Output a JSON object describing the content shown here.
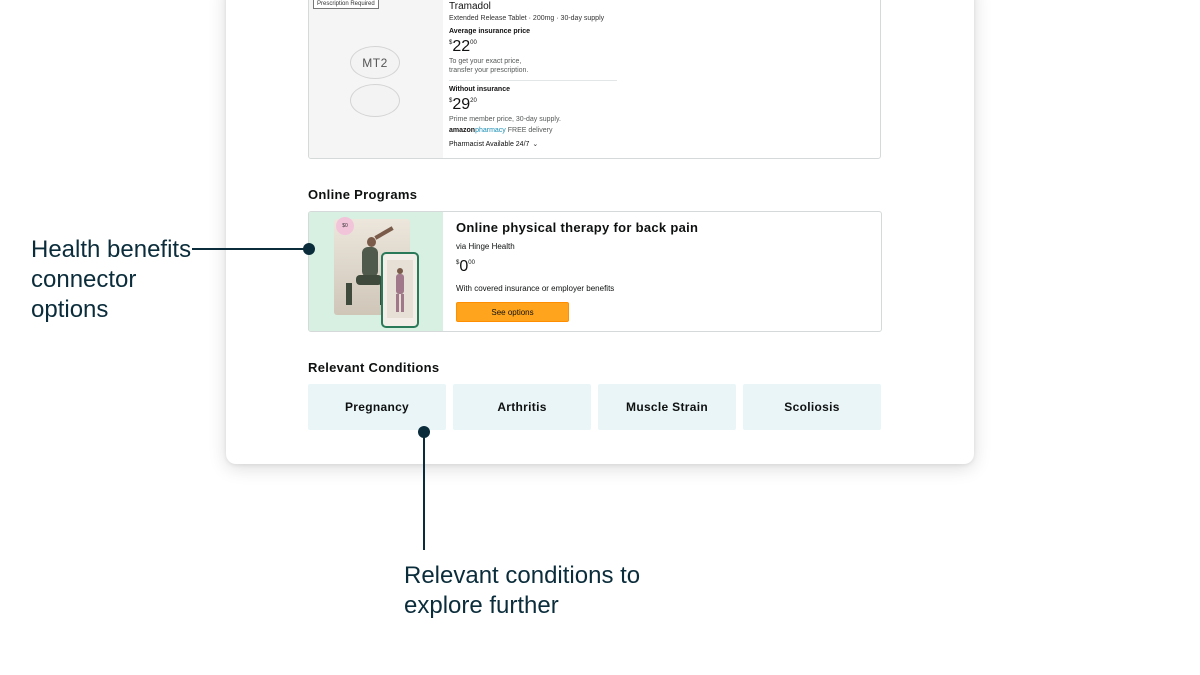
{
  "prescription": {
    "badge": "Prescription Required",
    "pill_imprint": "MT2",
    "name": "Tramadol",
    "form": "Extended Release Tablet · 200mg · 30-day supply",
    "avg_insurance_label": "Average insurance price",
    "avg_insurance_price_whole": "22",
    "avg_insurance_price_cents": "00",
    "price_currency": "$",
    "avg_insurance_note_1": "To get your exact price,",
    "avg_insurance_note_2": "transfer your prescription.",
    "without_insurance_label": "Without insurance",
    "without_insurance_price_whole": "29",
    "without_insurance_price_cents": "20",
    "without_insurance_note": "Prime member price, 30-day supply.",
    "logo_amazon": "amazon",
    "logo_pharmacy": "pharmacy",
    "delivery": "FREE delivery",
    "pharmacist": "Pharmacist Available 24/7"
  },
  "online_programs": {
    "section_title": "Online Programs",
    "image_badge": "$0",
    "title": "Online physical therapy for back pain",
    "via": "via Hinge Health",
    "price_currency": "$",
    "price_whole": "0",
    "price_cents": "00",
    "coverage": "With covered insurance or employer benefits",
    "button_label": "See options"
  },
  "relevant_conditions": {
    "section_title": "Relevant Conditions",
    "items": [
      "Pregnancy",
      "Arthritis",
      "Muscle Strain",
      "Scoliosis"
    ]
  },
  "annotations": {
    "health_benefits": [
      "Health benefits",
      "connector",
      "options"
    ],
    "relevant_conditions": [
      "Relevant conditions to",
      "explore further"
    ]
  },
  "colors": {
    "annotation": "#0b2d3b",
    "button": "#ffa41c",
    "condition_tile": "#e9f5f7",
    "program_image_bg": "#d8f0e2",
    "pharmacy_accent": "#1a8db5"
  }
}
